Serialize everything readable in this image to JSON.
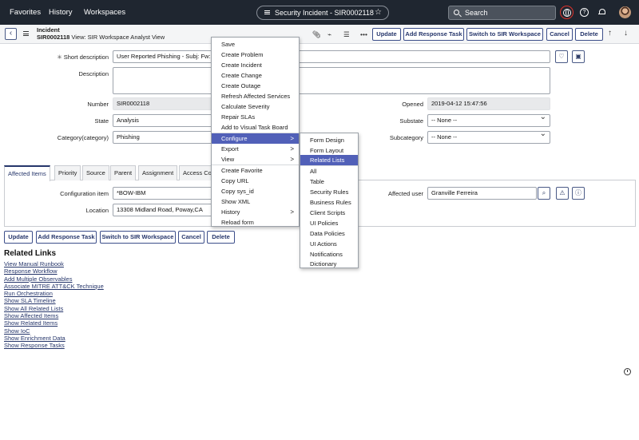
{
  "nav": {
    "favorites": "Favorites",
    "history": "History",
    "workspaces": "Workspaces",
    "scope_title": "Security Incident - SIR0002118",
    "search_placeholder": "Search"
  },
  "header": {
    "record_type": "Incident",
    "record_number": "SIR0002118",
    "view_label": "View: SIR Workspace Analyst View",
    "buttons": {
      "update": "Update",
      "add_response_task": "Add Response Task",
      "switch_workspace": "Switch to SIR Workspace",
      "cancel": "Cancel",
      "delete": "Delete"
    }
  },
  "form": {
    "short_description_label": "Short description",
    "short_description_value": "User Reported Phishing - Subj: Fw: S",
    "description_label": "Description",
    "description_value": "",
    "number_label": "Number",
    "number_value": "SIR0002118",
    "state_label": "State",
    "state_value": "Analysis",
    "category_label": "Category(category)",
    "category_value": "Phishing",
    "opened_label": "Opened",
    "opened_value": "2019-04-12 15:47:56",
    "substate_label": "Substate",
    "substate_value": "-- None --",
    "subcategory_label": "Subcategory",
    "subcategory_value": "-- None --"
  },
  "tabs": [
    {
      "label": "Affected Items"
    },
    {
      "label": "Priority"
    },
    {
      "label": "Source"
    },
    {
      "label": "Parent"
    },
    {
      "label": "Assignment"
    },
    {
      "label": "Access Co"
    }
  ],
  "affected": {
    "config_item_label": "Configuration item",
    "config_item_value": "*BOW-IBM",
    "location_label": "Location",
    "location_value": "13308 Midland Road, Poway,CA",
    "affected_user_label": "Affected user",
    "affected_user_value": "Granville Ferreira"
  },
  "bottom_buttons": {
    "update": "Update",
    "add_response_task": "Add Response Task",
    "switch_workspace": "Switch to SIR Workspace",
    "cancel": "Cancel",
    "delete": "Delete"
  },
  "related_links": {
    "title": "Related Links",
    "items": [
      "View Manual Runbook",
      "Response Workflow",
      "Add Multiple Observables",
      "Associate MITRE ATT&CK Technique",
      "Run Orchestration",
      "Show SLA Timeline",
      "Show All Related Lists",
      "Show Affected Items",
      "Show Related Items",
      "Show IoC",
      "Show Enrichment Data",
      "Show Response Tasks"
    ]
  },
  "context_menu": {
    "items": [
      "Save",
      "Create Problem",
      "Create Incident",
      "Create Change",
      "Create Outage",
      "Refresh Affected Services",
      "Calculate Severity",
      "Repair SLAs",
      "Add to Visual Task Board",
      "Configure",
      "Export",
      "View",
      "Create Favorite",
      "Copy URL",
      "Copy sys_id",
      "Show XML",
      "History",
      "Reload form"
    ],
    "submenu_arrow": ">"
  },
  "configure_menu": {
    "items": [
      "Form Design",
      "Form Layout",
      "Related Lists",
      "All",
      "Table",
      "Security Rules",
      "Business Rules",
      "Client Scripts",
      "UI Policies",
      "Data Policies",
      "UI Actions",
      "Notifications",
      "Dictionary"
    ]
  },
  "colors": {
    "nav_bg": "#1f2630",
    "accent": "#26366b",
    "menu_highlight": "#5160b8",
    "globe_ring": "#e0332c"
  }
}
